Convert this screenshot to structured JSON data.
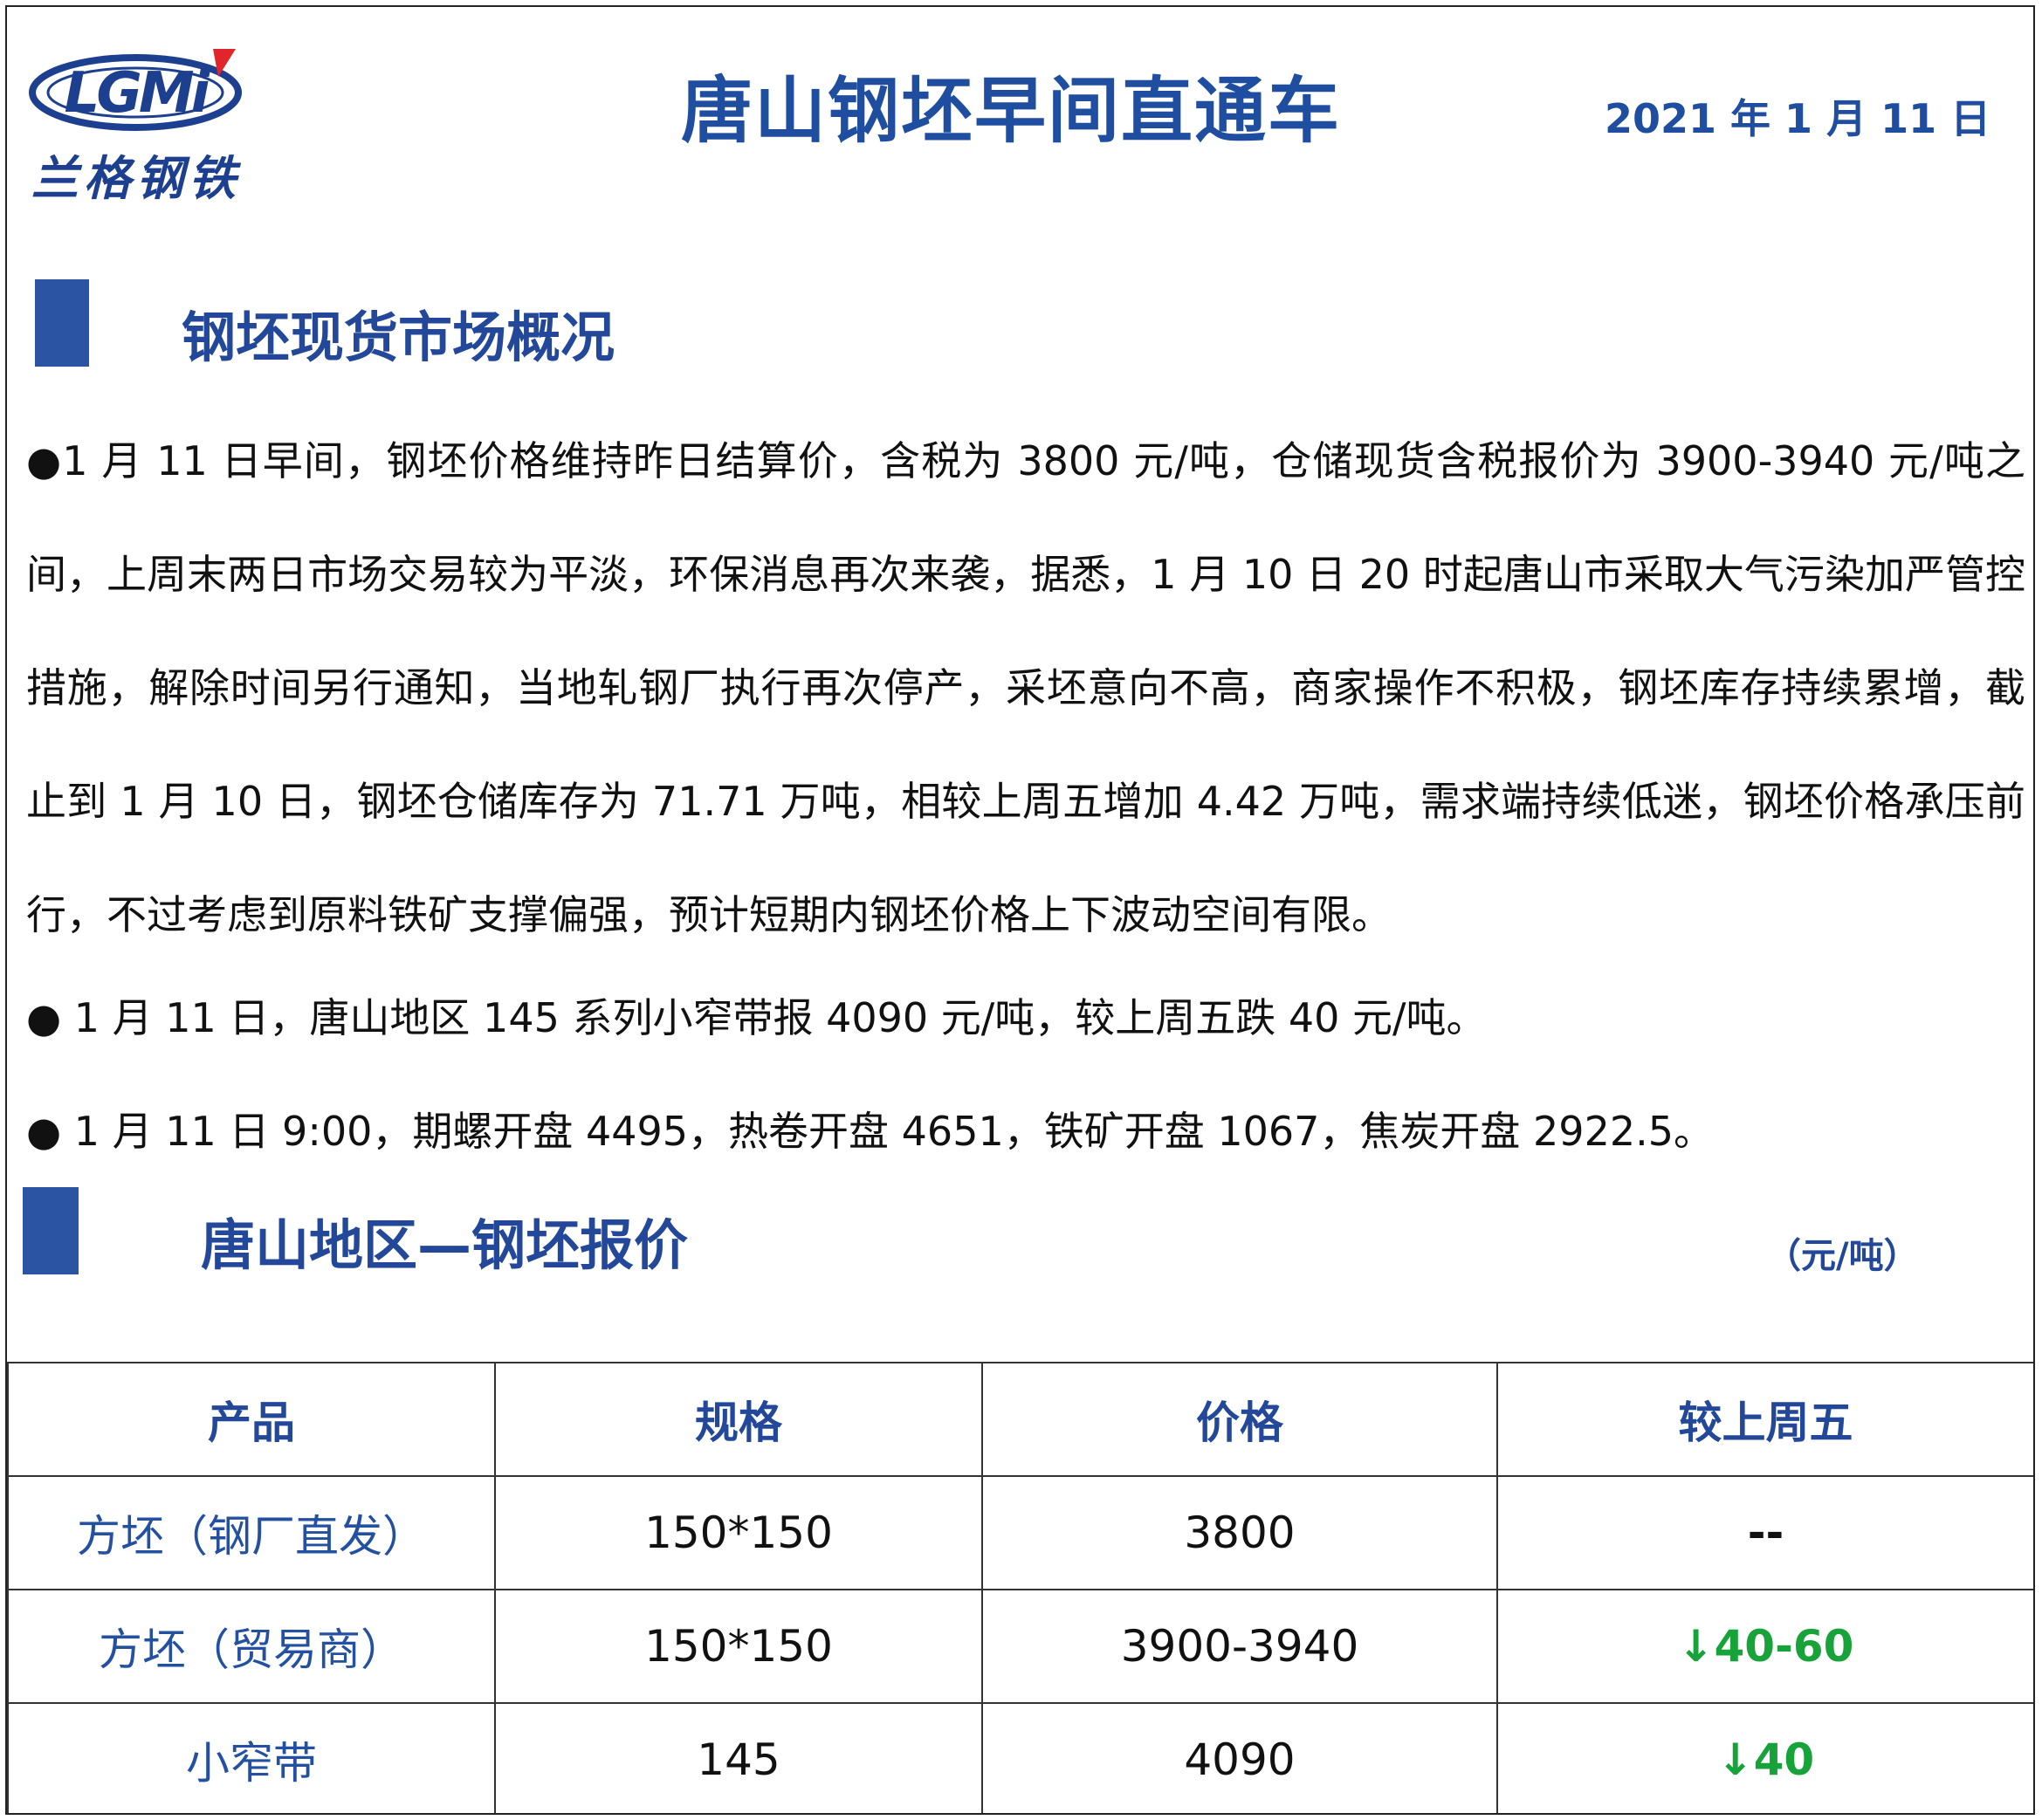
{
  "header": {
    "logo_text": "LGMi",
    "logo_cn": "兰格钢铁",
    "title": "唐山钢坯早间直通车",
    "date": "2021 年 1 月 11 日"
  },
  "colors": {
    "brand_blue": "#1f4ea0",
    "section_bar": "#2b55a3",
    "down_green": "#18a33a",
    "logo_red": "#e0262b"
  },
  "section1": {
    "title": "钢坯现货市场概况",
    "paragraph": "●1 月 11 日早间，钢坯价格维持昨日结算价，含税为 3800 元/吨，仓储现货含税报价为 3900-3940 元/吨之间，上周末两日市场交易较为平淡，环保消息再次来袭，据悉，1 月 10 日 20 时起唐山市采取大气污染加严管控措施，解除时间另行通知，当地轧钢厂执行再次停产，采坯意向不高，商家操作不积极，钢坯库存持续累增，截止到 1 月 10 日，钢坯仓储库存为 71.71 万吨，相较上周五增加 4.42 万吨，需求端持续低迷，钢坯价格承压前行，不过考虑到原料铁矿支撑偏强，预计短期内钢坯价格上下波动空间有限。",
    "bullet1": "●  1 月 11 日，唐山地区 145 系列小窄带报 4090 元/吨，较上周五跌 40 元/吨。",
    "bullet2": "●  1 月 11 日 9:00，期螺开盘 4495，热卷开盘 4651，铁矿开盘 1067，焦炭开盘 2922.5。"
  },
  "section2": {
    "title": "唐山地区—钢坯报价",
    "unit": "（元/吨）"
  },
  "table": {
    "headers": [
      "产品",
      "规格",
      "价格",
      "较上周五"
    ],
    "rows": [
      {
        "product": "方坯（钢厂直发）",
        "spec": "150*150",
        "price": "3800",
        "change": "--"
      },
      {
        "product": "方坯（贸易商）",
        "spec": "150*150",
        "price": "3900-3940",
        "change": "↓40-60"
      },
      {
        "product": "小窄带",
        "spec": "145",
        "price": "4090",
        "change": "↓40"
      }
    ]
  }
}
